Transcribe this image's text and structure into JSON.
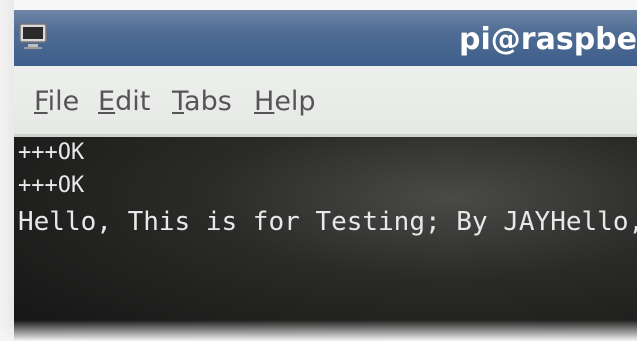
{
  "window": {
    "title": "pi@raspbe"
  },
  "menu": {
    "items": [
      {
        "label_first": "F",
        "label_rest": "ile"
      },
      {
        "label_first": "E",
        "label_rest": "dit"
      },
      {
        "label_first": "T",
        "label_rest": "abs"
      },
      {
        "label_first": "H",
        "label_rest": "elp"
      }
    ]
  },
  "terminal": {
    "lines": [
      "+++OK",
      "+++OK",
      "Hello, This is for Testing; By JAYHello,"
    ]
  },
  "colors": {
    "titlebar": "#4f6c93",
    "menubar": "#e9ebe9",
    "terminal_bg": "#222222",
    "terminal_text": "#e8e8e8"
  }
}
